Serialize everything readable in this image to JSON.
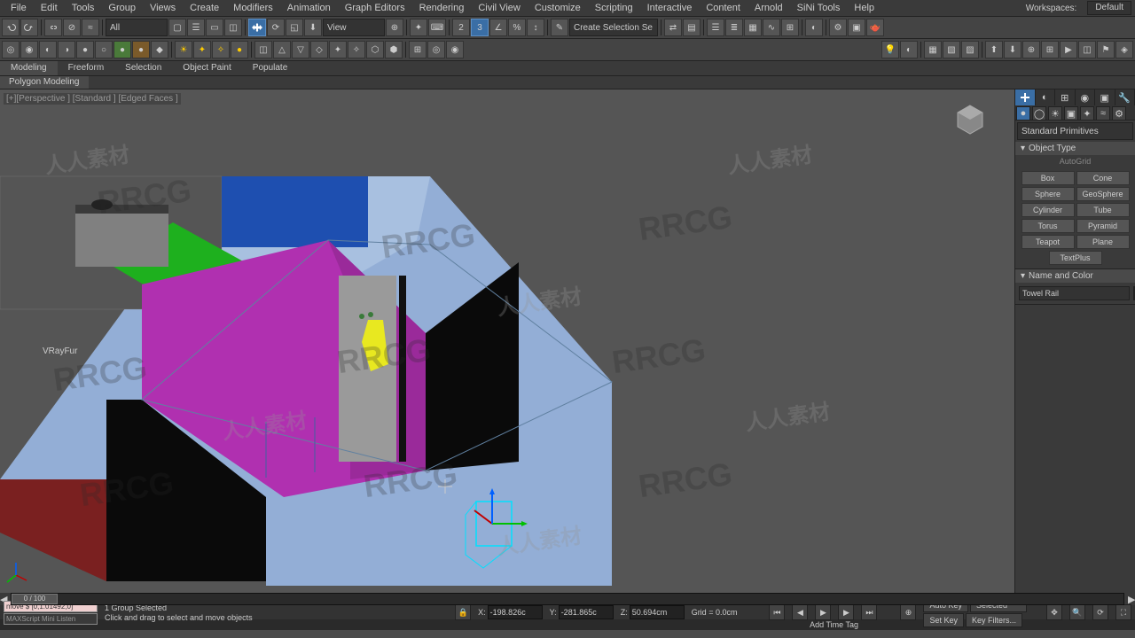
{
  "workspace": {
    "label": "Workspaces:",
    "value": "Default"
  },
  "menus": [
    "File",
    "Edit",
    "Tools",
    "Group",
    "Views",
    "Create",
    "Modifiers",
    "Animation",
    "Graph Editors",
    "Rendering",
    "Civil View",
    "Customize",
    "Scripting",
    "Interactive",
    "Content",
    "Arnold",
    "SiNi Tools",
    "Help"
  ],
  "ribbon_tabs": [
    "Modeling",
    "Freeform",
    "Selection",
    "Object Paint",
    "Populate"
  ],
  "ribbon_active": "Modeling",
  "subribbon": "Polygon Modeling",
  "viewport": {
    "label": "[+][Perspective ] [Standard ] [Edged Faces ]",
    "overlay": "VRayFur"
  },
  "toolbar_combos": {
    "all": "All",
    "view": "View",
    "sel": "Create Selection Se"
  },
  "cmd_panel": {
    "dropdown": "Standard Primitives",
    "object_type_header": "Object Type",
    "auto_grid": "AutoGrid",
    "prims": [
      "Box",
      "Cone",
      "Sphere",
      "GeoSphere",
      "Cylinder",
      "Tube",
      "Torus",
      "Pyramid",
      "Teapot",
      "Plane",
      "TextPlus"
    ],
    "name_color_header": "Name and Color",
    "name_value": "Towel Rail",
    "swatch": "#8ec24a"
  },
  "timeline": {
    "thumb": "0 / 100"
  },
  "track": {
    "sel": "1 Group Selected",
    "hint": "Click and drag to select and move objects"
  },
  "status": {
    "script_in": "move $ [0,1.01492,0]",
    "listener": "MAXScript Mini Listen",
    "x": "-198.826c",
    "y": "-281.865c",
    "z": "50.694cm",
    "grid": "Grid = 0.0cm",
    "auto_key": "Auto Key",
    "selected": "Selected",
    "add_time_tag": "Add Time Tag",
    "set_key": "Set Key",
    "key_filters": "Key Filters..."
  }
}
